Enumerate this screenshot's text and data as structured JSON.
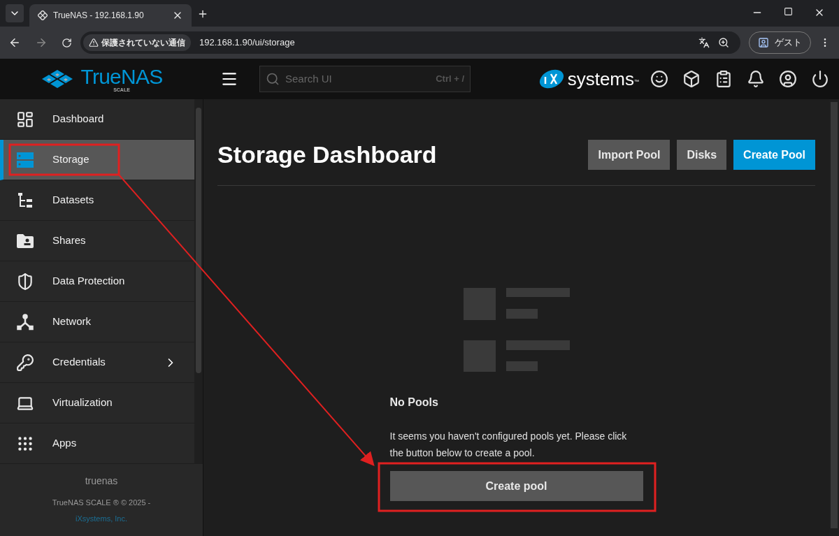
{
  "browser": {
    "tab_title": "TrueNAS - 192.168.1.90",
    "security_label": "保護されていない通信",
    "url": "192.168.1.90/ui/storage",
    "profile_label": "ゲスト"
  },
  "header": {
    "logo_text": "TrueNAS",
    "logo_sub": "SCALE",
    "search_placeholder": "Search UI",
    "search_shortcut": "Ctrl + /",
    "brand_text": "systems",
    "brand_tm": "™"
  },
  "sidebar": {
    "items": [
      {
        "label": "Dashboard",
        "selected": false,
        "kind": "link"
      },
      {
        "label": "Storage",
        "selected": true,
        "kind": "link"
      },
      {
        "label": "Datasets",
        "selected": false,
        "kind": "link"
      },
      {
        "label": "Shares",
        "selected": false,
        "kind": "link"
      },
      {
        "label": "Data Protection",
        "selected": false,
        "kind": "link"
      },
      {
        "label": "Network",
        "selected": false,
        "kind": "link"
      },
      {
        "label": "Credentials",
        "selected": false,
        "kind": "group"
      },
      {
        "label": "Virtualization",
        "selected": false,
        "kind": "link"
      },
      {
        "label": "Apps",
        "selected": false,
        "kind": "link"
      }
    ],
    "hostname": "truenas",
    "copyright": "TrueNAS SCALE ® © 2025 -",
    "company_link": "iXsystems, Inc."
  },
  "main": {
    "title": "Storage Dashboard",
    "buttons": [
      {
        "label": "Import Pool",
        "kind": "secondary"
      },
      {
        "label": "Disks",
        "kind": "secondary"
      },
      {
        "label": "Create Pool",
        "kind": "primary"
      }
    ],
    "empty_state": {
      "title": "No Pools",
      "message": "It seems you haven't configured pools yet. Please click the button below to create a pool.",
      "button": "Create pool"
    }
  }
}
